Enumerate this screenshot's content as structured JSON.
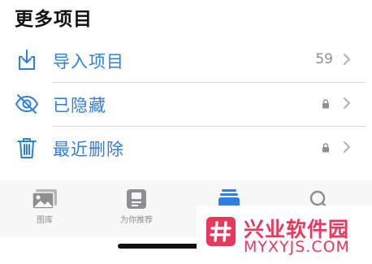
{
  "section": {
    "title": "更多项目"
  },
  "rows": [
    {
      "label": "导入项目",
      "count": "59",
      "icon": "import-icon"
    },
    {
      "label": "已隐藏",
      "icon": "eye-slash-icon",
      "locked": true
    },
    {
      "label": "最近删除",
      "icon": "trash-icon",
      "locked": true
    }
  ],
  "tabs": [
    {
      "label": "图库",
      "icon": "photos-icon"
    },
    {
      "label": "为你推荐",
      "icon": "for-you-icon"
    },
    {
      "label": "",
      "icon": "albums-icon",
      "active": true
    },
    {
      "label": "",
      "icon": "search-icon"
    }
  ],
  "watermark": {
    "cn": "兴业软件园",
    "en": "MYXYJS.COM"
  },
  "colors": {
    "accent": "#2f7fe0",
    "secondary": "#8e8e93",
    "watermark": "#e8395d"
  }
}
